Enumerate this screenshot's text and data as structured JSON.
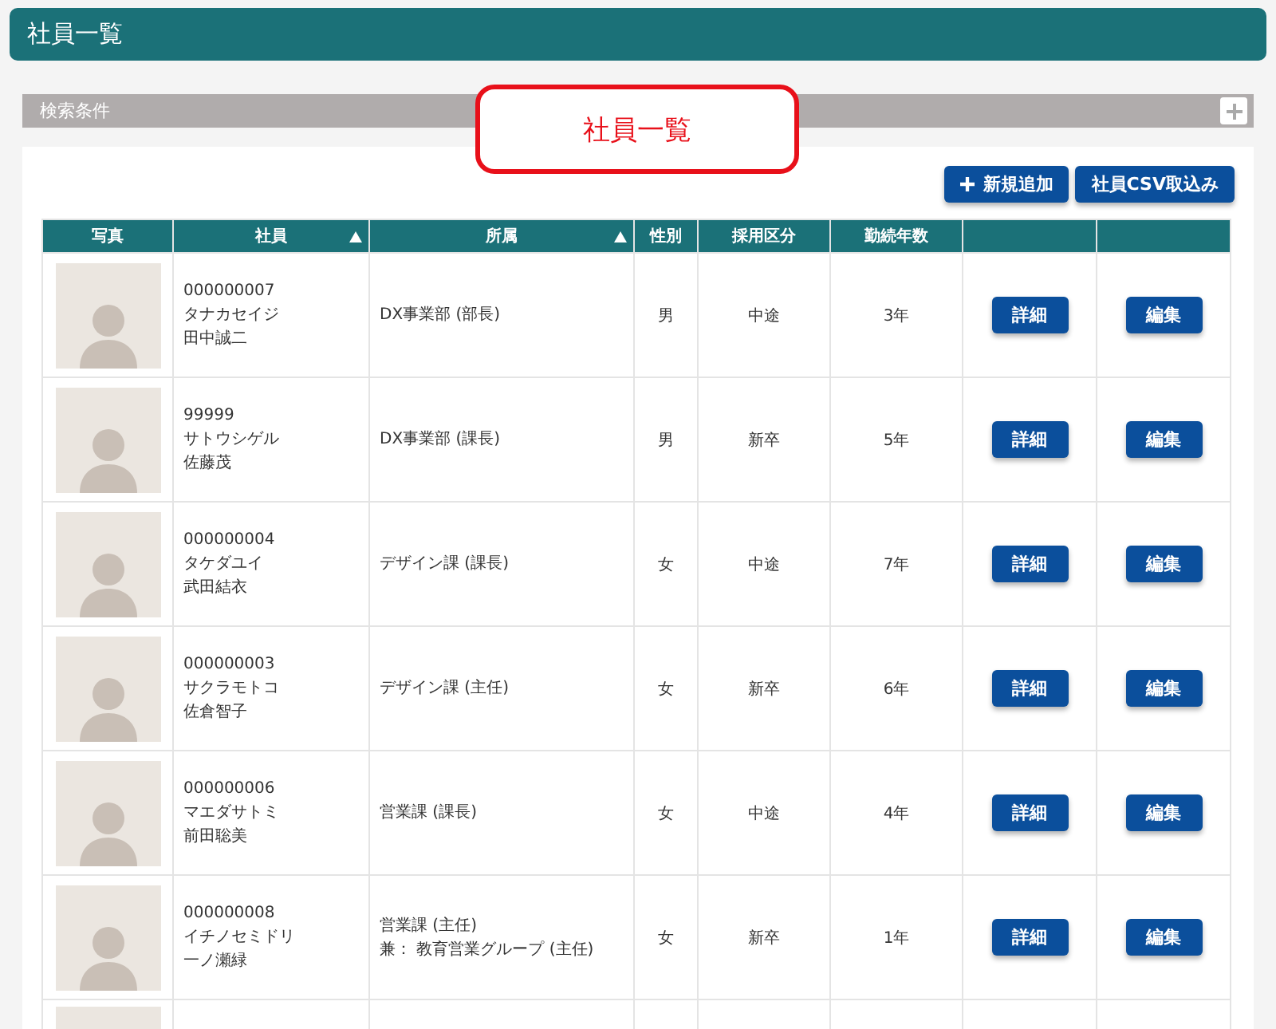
{
  "header": {
    "title": "社員一覧"
  },
  "search_panel": {
    "title": "検索条件",
    "expanded": false
  },
  "callout": {
    "text": "社員一覧"
  },
  "actions": [
    {
      "label": "新規追加",
      "kind": "add"
    },
    {
      "label": "社員CSV取込み",
      "kind": "plain"
    }
  ],
  "table": {
    "columns": [
      {
        "label": "写真",
        "sortable": false
      },
      {
        "label": "社員",
        "sortable": true
      },
      {
        "label": "所属",
        "sortable": true
      },
      {
        "label": "性別",
        "sortable": false
      },
      {
        "label": "採用区分",
        "sortable": false
      },
      {
        "label": "勤続年数",
        "sortable": false
      },
      {
        "sortable": false
      },
      {
        "sortable": false
      }
    ],
    "rows": [
      {
        "id": "000000007",
        "kana": "タナカセイジ",
        "name": "田中誠二",
        "department": [
          "DX事業部 (部長)"
        ],
        "gender": "男",
        "hire_type": "中途",
        "tenure": "3年",
        "detail": "詳細",
        "edit": "編集"
      },
      {
        "id": "99999",
        "kana": "サトウシゲル",
        "name": "佐藤茂",
        "department": [
          "DX事業部 (課長)"
        ],
        "gender": "男",
        "hire_type": "新卒",
        "tenure": "5年",
        "detail": "詳細",
        "edit": "編集"
      },
      {
        "id": "000000004",
        "kana": "タケダユイ",
        "name": "武田結衣",
        "department": [
          "デザイン課 (課長)"
        ],
        "gender": "女",
        "hire_type": "中途",
        "tenure": "7年",
        "detail": "詳細",
        "edit": "編集"
      },
      {
        "id": "000000003",
        "kana": "サクラモトコ",
        "name": "佐倉智子",
        "department": [
          "デザイン課 (主任)"
        ],
        "gender": "女",
        "hire_type": "新卒",
        "tenure": "6年",
        "detail": "詳細",
        "edit": "編集"
      },
      {
        "id": "000000006",
        "kana": "マエダサトミ",
        "name": "前田聡美",
        "department": [
          "営業課 (課長)"
        ],
        "gender": "女",
        "hire_type": "中途",
        "tenure": "4年",
        "detail": "詳細",
        "edit": "編集"
      },
      {
        "id": "000000008",
        "kana": "イチノセミドリ",
        "name": "一ノ瀬緑",
        "department": [
          "営業課 (主任)",
          "兼： 教育営業グループ (主任)"
        ],
        "gender": "女",
        "hire_type": "新卒",
        "tenure": "1年",
        "detail": "詳細",
        "edit": "編集"
      }
    ]
  }
}
